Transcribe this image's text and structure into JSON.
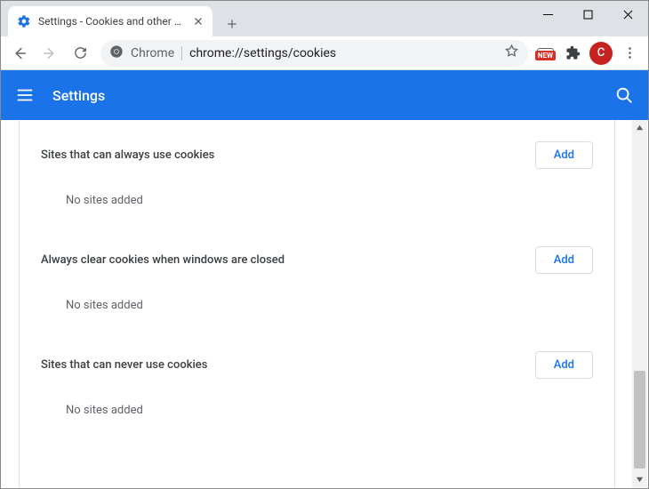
{
  "window": {
    "tab_title": "Settings - Cookies and other site"
  },
  "toolbar": {
    "origin_label": "Chrome",
    "url": "chrome://settings/cookies",
    "avatar_letter": "C",
    "new_badge": "NEW"
  },
  "appbar": {
    "title": "Settings"
  },
  "sections": [
    {
      "title": "Sites that can always use cookies",
      "add_label": "Add",
      "empty_text": "No sites added"
    },
    {
      "title": "Always clear cookies when windows are closed",
      "add_label": "Add",
      "empty_text": "No sites added"
    },
    {
      "title": "Sites that can never use cookies",
      "add_label": "Add",
      "empty_text": "No sites added"
    }
  ]
}
